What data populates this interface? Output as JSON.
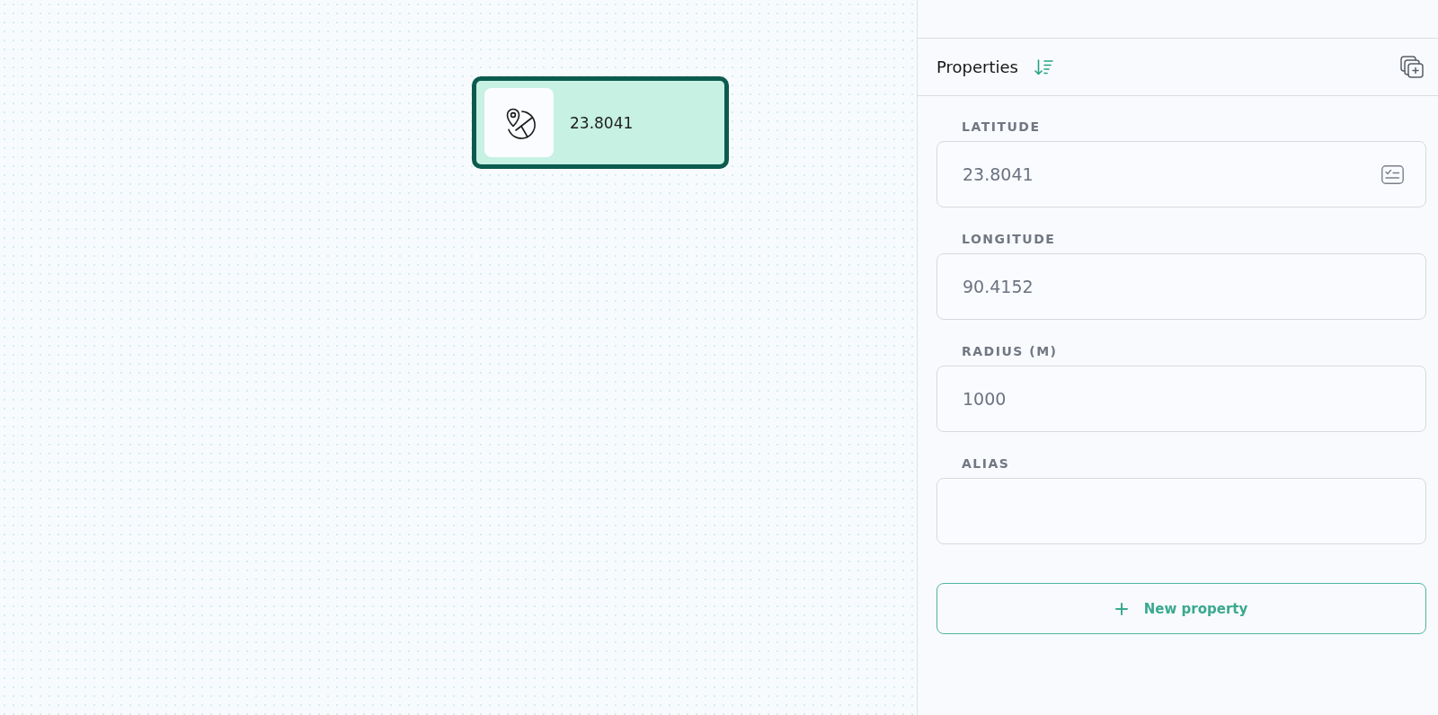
{
  "canvas": {
    "nodes": [
      {
        "kind": "location",
        "label": "23.8041",
        "selected": true
      }
    ]
  },
  "panel": {
    "title": "Properties",
    "fields": [
      {
        "label": "LATITUDE",
        "value": "23.8041",
        "kind": "picker"
      },
      {
        "label": "LONGITUDE",
        "value": "90.4152",
        "kind": "text"
      },
      {
        "label": "RADIUS (M)",
        "value": "1000",
        "kind": "text"
      },
      {
        "label": "ALIAS",
        "kind": "text"
      }
    ],
    "add_button": "New property"
  }
}
